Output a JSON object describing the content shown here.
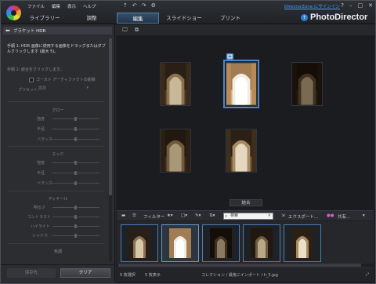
{
  "menu": [
    "ファイル",
    "編集",
    "表示",
    "ヘルプ"
  ],
  "menu_icons": [
    "up-arrow-icon",
    "undo-icon",
    "redo-icon",
    "gear-icon"
  ],
  "directorzone_link": "DirectorZone にサインイン",
  "window_controls": [
    "?",
    "–",
    "□",
    "✕"
  ],
  "tabs": [
    {
      "label": "ライブラリー",
      "active": false
    },
    {
      "label": "調整",
      "active": false
    },
    {
      "label": "編集",
      "active": true
    },
    {
      "label": "スライドショー",
      "active": false
    },
    {
      "label": "プリント",
      "active": false
    }
  ],
  "brand": "PhotoDirector",
  "left_panel": {
    "title": "ブラケット HDR",
    "step1": "手順 1: HDR 画像に使用する画像をドラッグまたはダブルクリックします (最大 5)。",
    "step2": "手順 2: 結合をクリックします。",
    "ghost_label": "ゴースト アーティファクトの削除",
    "preset_label": "プリセット:",
    "preset_value": "標準",
    "groups": [
      {
        "title": "グロー",
        "sliders": [
          "強度",
          "半径",
          "バランス"
        ]
      },
      {
        "title": "エッジ",
        "sliders": [
          "強度",
          "半径",
          "バランス"
        ]
      },
      {
        "title": "ディテール",
        "sliders": [
          "明るさ",
          "コントラスト",
          "ハイライト",
          "シャドウ"
        ]
      },
      {
        "title": "色調",
        "sliders": []
      }
    ],
    "save_label": "保存先",
    "clear_label": "クリア"
  },
  "view_toolbar_icons": [
    "monitor-icon",
    "compare-view-icon"
  ],
  "combine_label": "結合",
  "film_toolbar": {
    "filter_label": "フィルター",
    "search_placeholder": "検索",
    "export_label": "エクスポート...",
    "share_label": "共有..."
  },
  "status": {
    "selected": "5 枚選択",
    "shown": "5 枚表示",
    "path": "コレクション / 最後にインポート / h_5.jpg"
  },
  "colors": {
    "accent": "#4a86c8",
    "link": "#4aa0ff",
    "brand_icon": "#2f7fd8"
  }
}
